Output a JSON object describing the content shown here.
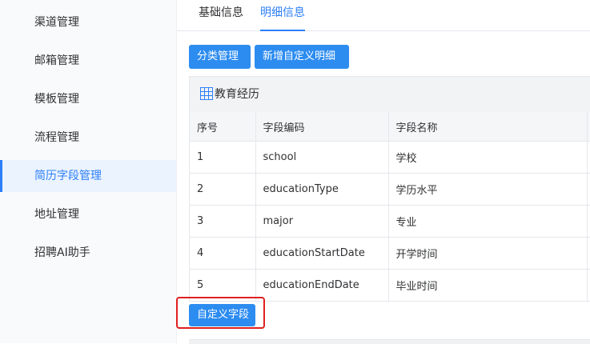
{
  "sidebar": {
    "items": [
      {
        "label": "渠道管理"
      },
      {
        "label": "邮箱管理"
      },
      {
        "label": "模板管理"
      },
      {
        "label": "流程管理"
      },
      {
        "label": "简历字段管理"
      },
      {
        "label": "地址管理"
      },
      {
        "label": "招聘AI助手"
      }
    ],
    "active_index": 4
  },
  "tabs": [
    {
      "label": "基础信息"
    },
    {
      "label": "明细信息"
    }
  ],
  "toolbar": {
    "category_label": "分类管理",
    "add_custom_detail_label": "新增自定义明细"
  },
  "panel": {
    "icon": "table-icon",
    "title": "教育经历",
    "columns": [
      "序号",
      "字段编码",
      "字段名称"
    ],
    "rows": [
      [
        "1",
        "school",
        "学校"
      ],
      [
        "2",
        "educationType",
        "学历水平"
      ],
      [
        "3",
        "major",
        "专业"
      ],
      [
        "4",
        "educationStartDate",
        "开学时间"
      ],
      [
        "5",
        "educationEndDate",
        "毕业时间"
      ]
    ]
  },
  "custom_field_button": {
    "label": "自定义字段"
  },
  "colors": {
    "accent": "#2d7ff9",
    "button": "#2d8cf0",
    "highlight": "#e02020"
  }
}
